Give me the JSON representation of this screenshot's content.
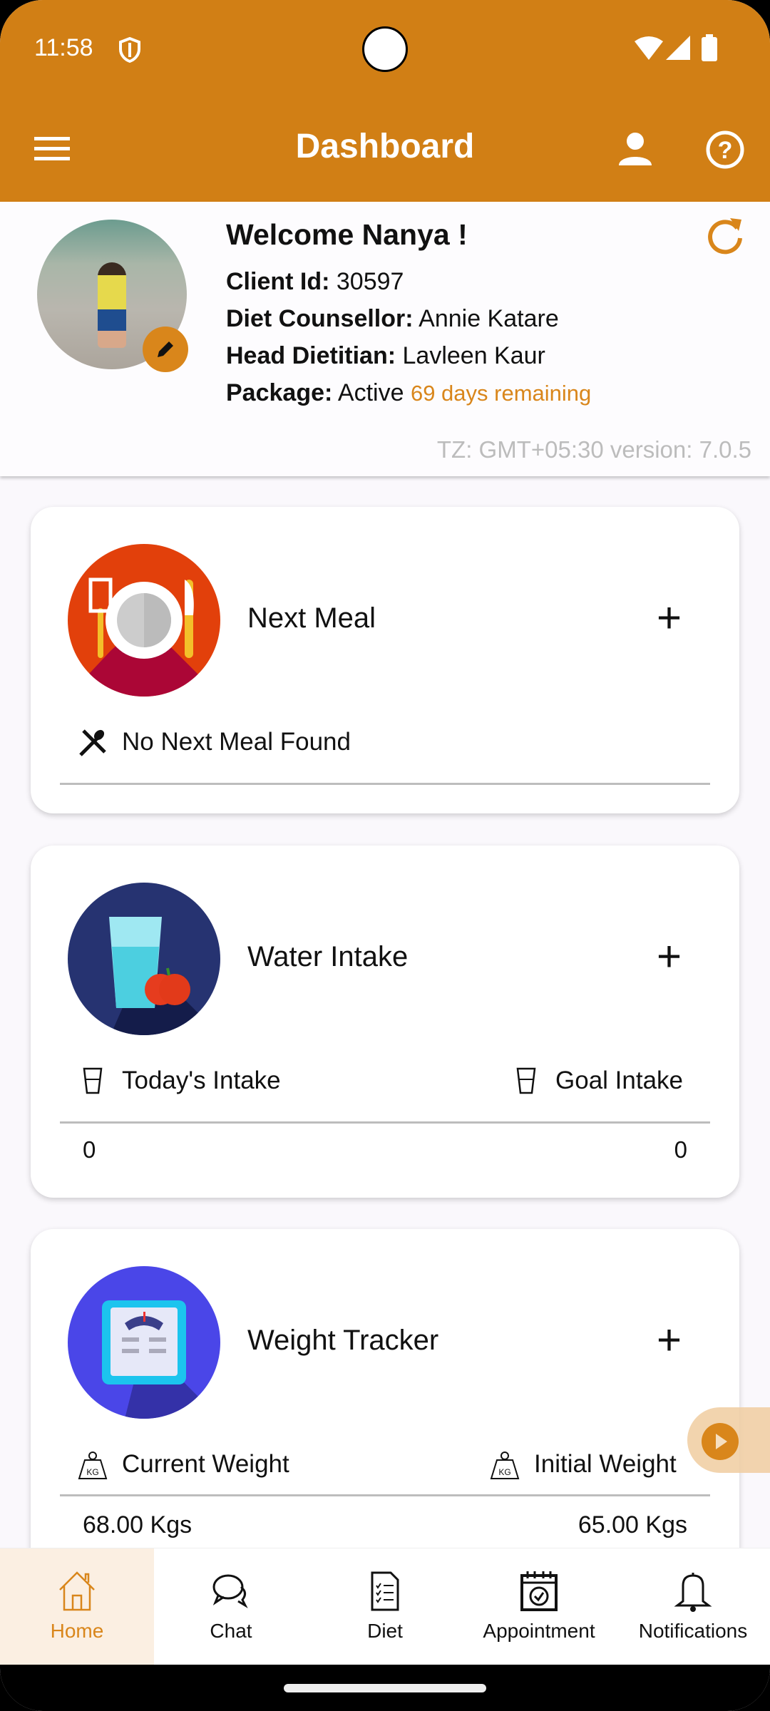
{
  "status_bar": {
    "time": "11:58"
  },
  "header": {
    "title": "Dashboard"
  },
  "profile": {
    "welcome": "Welcome Nanya !",
    "client_id_label": "Client Id:",
    "client_id": "30597",
    "counsellor_label": "Diet Counsellor:",
    "counsellor": "Annie Katare",
    "dietitian_label": "Head Dietitian:",
    "dietitian": "Lavleen Kaur",
    "package_label": "Package:",
    "package_status": "Active",
    "package_remaining": "69 days remaining",
    "footer": "TZ: GMT+05:30 version: 7.0.5"
  },
  "cards": {
    "meal": {
      "title": "Next Meal",
      "empty": "No Next Meal Found"
    },
    "water": {
      "title": "Water Intake",
      "today_label": "Today's Intake",
      "goal_label": "Goal Intake",
      "today_value": "0",
      "goal_value": "0"
    },
    "weight": {
      "title": "Weight Tracker",
      "current_label": "Current Weight",
      "initial_label": "Initial Weight",
      "current_value": "68.00 Kgs",
      "initial_value": "65.00 Kgs"
    }
  },
  "nav": {
    "items": [
      {
        "label": "Home",
        "active": true
      },
      {
        "label": "Chat"
      },
      {
        "label": "Diet"
      },
      {
        "label": "Appointment"
      },
      {
        "label": "Notifications"
      }
    ]
  },
  "colors": {
    "brand": "#d17f15",
    "accent_text": "#d9861b"
  }
}
